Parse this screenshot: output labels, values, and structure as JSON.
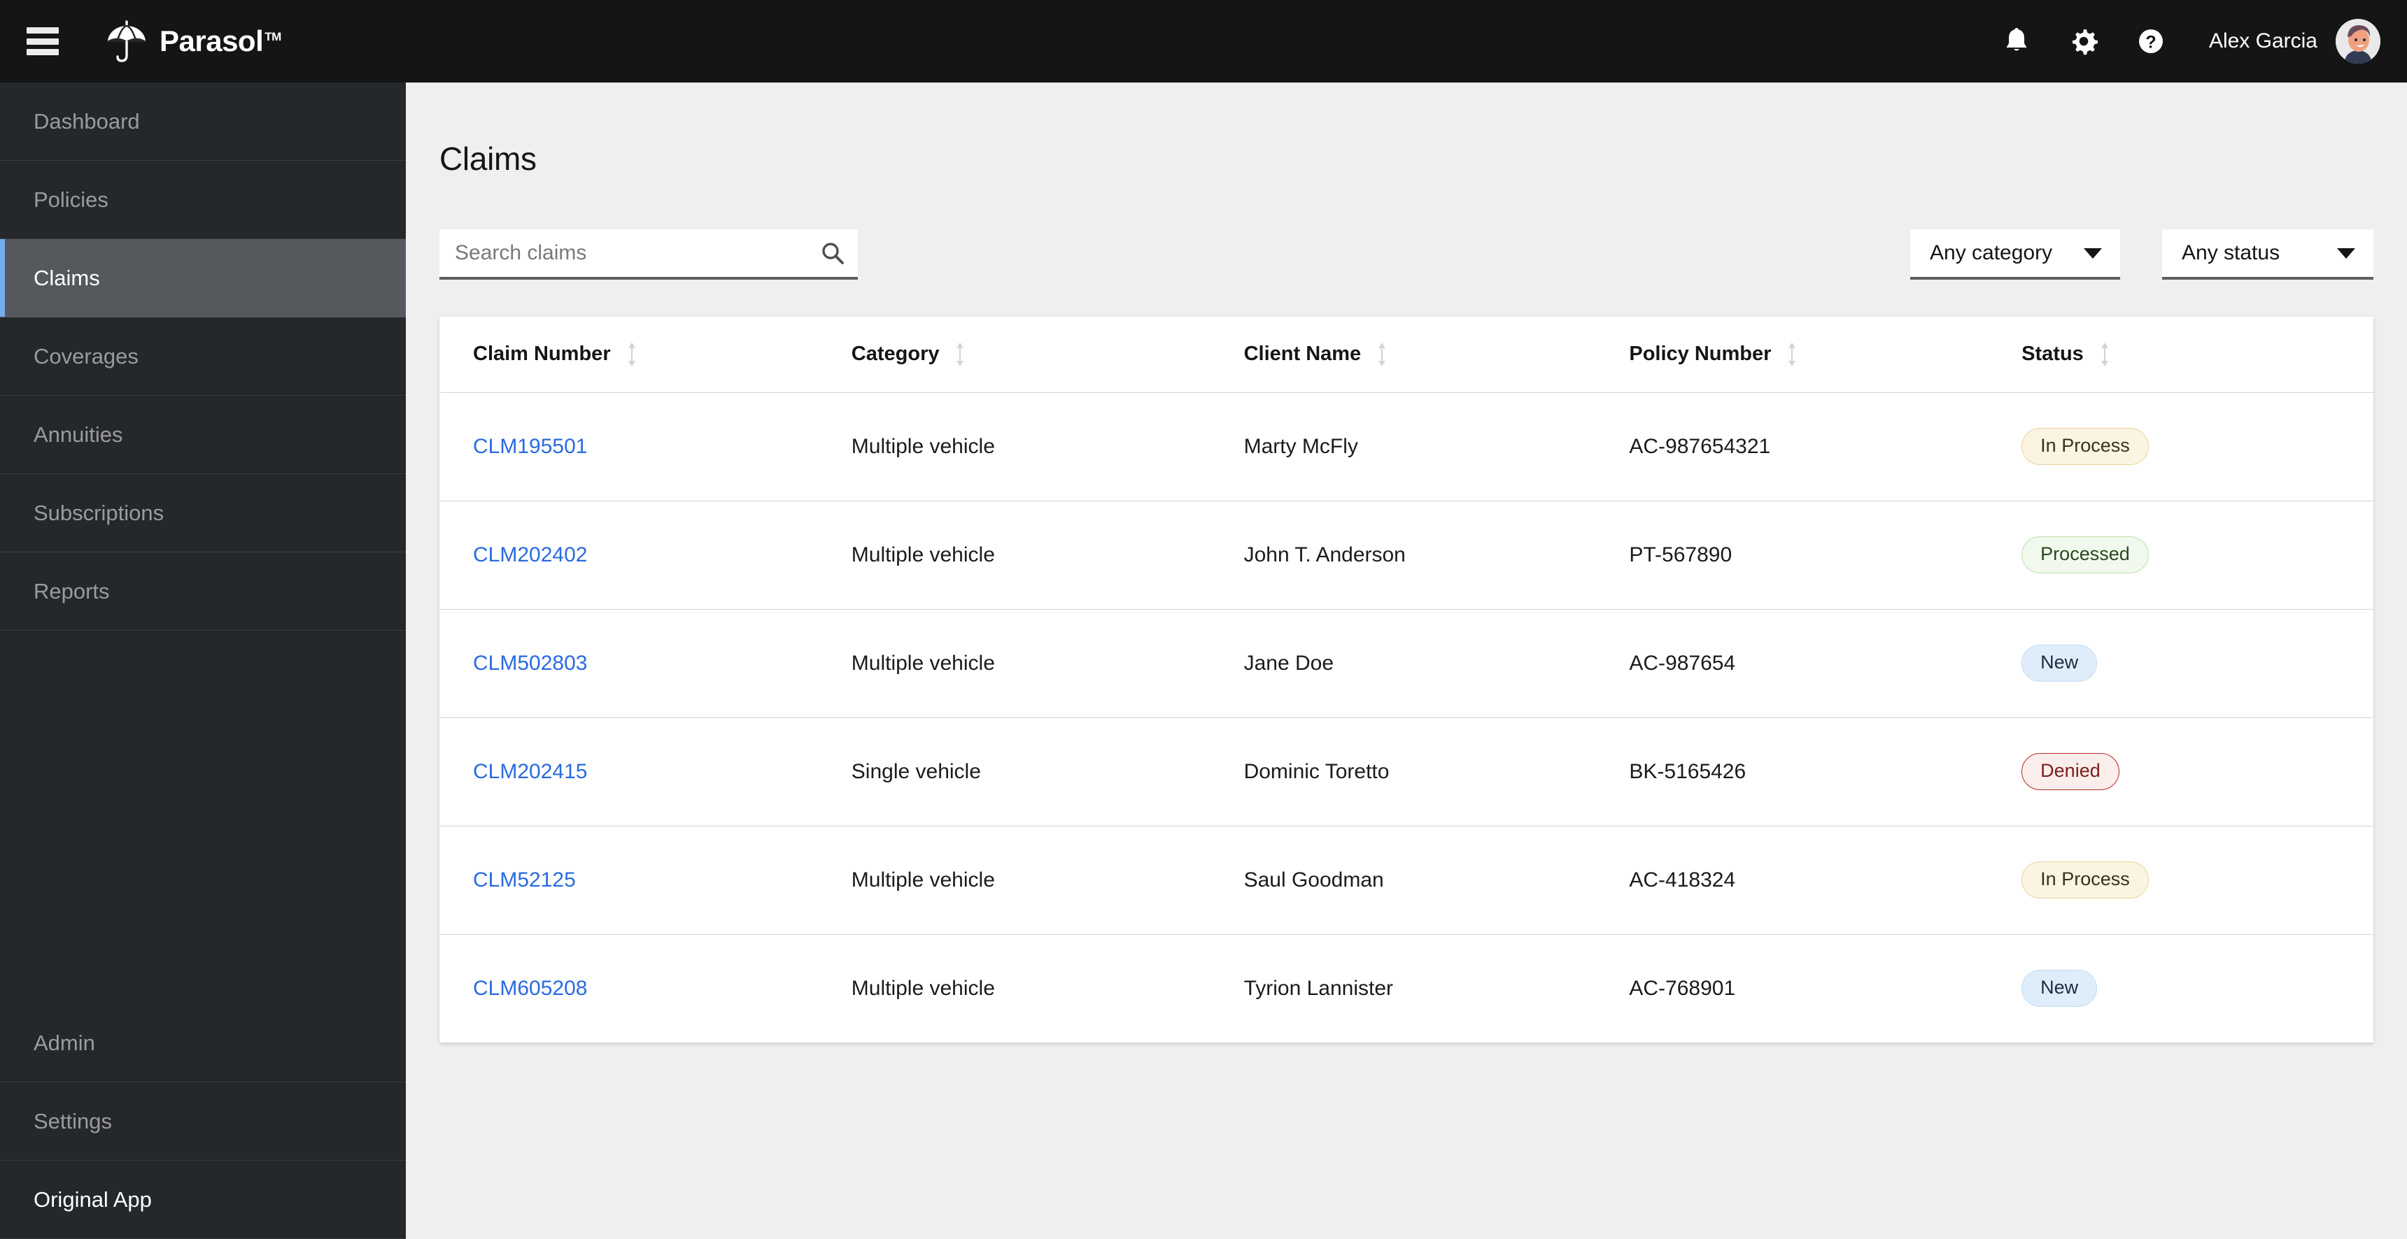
{
  "header": {
    "menu_icon": "hamburger-icon",
    "brand": "Parasol",
    "brand_tm": "TM",
    "logo_icon": "umbrella-icon",
    "notifications_icon": "bell-icon",
    "settings_icon": "gear-icon",
    "help_icon": "question-circle-icon",
    "user_name": "Alex Garcia",
    "avatar": "user-avatar"
  },
  "sidebar": {
    "items": [
      {
        "label": "Dashboard",
        "active": false,
        "bright": false
      },
      {
        "label": "Policies",
        "active": false,
        "bright": false
      },
      {
        "label": "Claims",
        "active": true,
        "bright": false
      },
      {
        "label": "Coverages",
        "active": false,
        "bright": false
      },
      {
        "label": "Annuities",
        "active": false,
        "bright": false
      },
      {
        "label": "Subscriptions",
        "active": false,
        "bright": false
      },
      {
        "label": "Reports",
        "active": false,
        "bright": false
      }
    ],
    "bottom_items": [
      {
        "label": "Admin",
        "bright": false
      },
      {
        "label": "Settings",
        "bright": false
      },
      {
        "label": "Original App",
        "bright": true
      }
    ],
    "active_accent_color": "#74aeea"
  },
  "main": {
    "page_title": "Claims",
    "search": {
      "placeholder": "Search claims",
      "value": "",
      "icon": "search-icon"
    },
    "filters": [
      {
        "label": "Any category",
        "icon": "chevron-down-icon"
      },
      {
        "label": "Any status",
        "icon": "chevron-down-icon"
      }
    ],
    "table": {
      "columns": [
        {
          "label": "Claim Number",
          "sort_icon": "sort-updown-icon"
        },
        {
          "label": "Category",
          "sort_icon": "sort-updown-icon"
        },
        {
          "label": "Client Name",
          "sort_icon": "sort-updown-icon"
        },
        {
          "label": "Policy Number",
          "sort_icon": "sort-updown-icon"
        },
        {
          "label": "Status",
          "sort_icon": "sort-updown-icon"
        }
      ],
      "rows": [
        {
          "claim_number": "CLM195501",
          "category": "Multiple vehicle",
          "client_name": "Marty McFly",
          "policy_number": "AC-987654321",
          "status": "In Process",
          "status_kind": "inprocess"
        },
        {
          "claim_number": "CLM202402",
          "category": "Multiple vehicle",
          "client_name": "John T. Anderson",
          "policy_number": "PT-567890",
          "status": "Processed",
          "status_kind": "processed"
        },
        {
          "claim_number": "CLM502803",
          "category": "Multiple vehicle",
          "client_name": "Jane Doe",
          "policy_number": "AC-987654",
          "status": "New",
          "status_kind": "new"
        },
        {
          "claim_number": "CLM202415",
          "category": "Single vehicle",
          "client_name": "Dominic Toretto",
          "policy_number": "BK-5165426",
          "status": "Denied",
          "status_kind": "denied"
        },
        {
          "claim_number": "CLM52125",
          "category": "Multiple vehicle",
          "client_name": "Saul Goodman",
          "policy_number": "AC-418324",
          "status": "In Process",
          "status_kind": "inprocess"
        },
        {
          "claim_number": "CLM605208",
          "category": "Multiple vehicle",
          "client_name": "Tyrion Lannister",
          "policy_number": "AC-768901",
          "status": "New",
          "status_kind": "new"
        }
      ]
    }
  },
  "colors": {
    "header_bg": "#151515",
    "sidebar_bg": "#25282b",
    "sidebar_active_bg": "#55585c",
    "accent_blue": "#74aeea",
    "link_blue": "#2a6ae0",
    "page_bg": "#efefef"
  }
}
